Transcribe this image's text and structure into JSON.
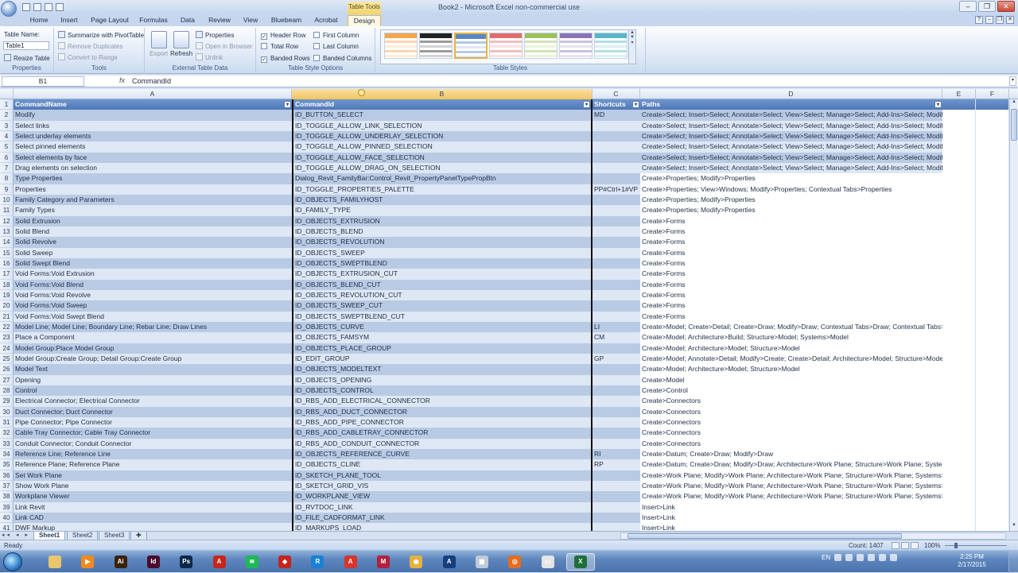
{
  "window": {
    "title": "Book2 - Microsoft Excel non-commercial use",
    "table_tools_label": "Table Tools",
    "controls": {
      "minimize": "–",
      "restore": "❐",
      "close": "✕"
    }
  },
  "tabs": [
    "Home",
    "Insert",
    "Page Layout",
    "Formulas",
    "Data",
    "Review",
    "View",
    "Bluebeam",
    "Acrobat",
    "Design"
  ],
  "ribbon": {
    "properties": {
      "table_name_label": "Table Name:",
      "table_name_value": "Table1",
      "resize_table": "Resize Table",
      "group_label": "Properties"
    },
    "tools": {
      "summarize": "Summarize with PivotTable",
      "remove_duplicates": "Remove Duplicates",
      "convert_to_range": "Convert to Range",
      "group_label": "Tools"
    },
    "external": {
      "export": "Export",
      "refresh": "Refresh",
      "properties": "Properties",
      "open_in_browser": "Open in Browser",
      "unlink": "Unlink",
      "group_label": "External Table Data"
    },
    "style_options": {
      "header_row": "Header Row",
      "total_row": "Total Row",
      "banded_rows": "Banded Rows",
      "first_column": "First Column",
      "last_column": "Last Column",
      "banded_columns": "Banded Columns",
      "group_label": "Table Style Options"
    },
    "table_styles": {
      "group_label": "Table Styles",
      "swatch_colors": [
        "#f3a64b",
        "#222222",
        "#5a86c4",
        "#e06c6c",
        "#9bc25a",
        "#8a74b8",
        "#57b6c9"
      ],
      "selected_index": 2
    }
  },
  "formula_bar": {
    "name_box": "B1",
    "fx": "fx",
    "content": "CommandId"
  },
  "columns": [
    "A",
    "B",
    "C",
    "D",
    "E",
    "F"
  ],
  "table": {
    "headers": [
      "CommandName",
      "CommandId",
      "Shortcuts",
      "Paths"
    ],
    "row_numbers": [
      "1",
      "2",
      "3",
      "4",
      "5",
      "6",
      "7",
      "8",
      "9",
      "10",
      "11",
      "12",
      "13",
      "14",
      "15",
      "16",
      "17",
      "18",
      "19",
      "20",
      "21",
      "22",
      "23",
      "24",
      "25",
      "26",
      "27",
      "28",
      "29",
      "30",
      "31",
      "32",
      "33",
      "34",
      "35",
      "36",
      "37",
      "38",
      "39",
      "40",
      "41"
    ],
    "rows": [
      [
        "Modify",
        "ID_BUTTON_SELECT",
        "MD",
        "Create>Select; Insert>Select; Annotate>Select; View>Select; Manage>Select; Add-Ins>Select; Modify>Select; Arc"
      ],
      [
        "Select links",
        "ID_TOGGLE_ALLOW_LINK_SELECTION",
        "",
        "Create>Select; Insert>Select; Annotate>Select; View>Select; Manage>Select; Add-Ins>Select; Modify>Select; Arc"
      ],
      [
        "Select underlay elements",
        "ID_TOGGLE_ALLOW_UNDERLAY_SELECTION",
        "",
        "Create>Select; Insert>Select; Annotate>Select; View>Select; Manage>Select; Add-Ins>Select; Modify>Select; Arc"
      ],
      [
        "Select pinned elements",
        "ID_TOGGLE_ALLOW_PINNED_SELECTION",
        "",
        "Create>Select; Insert>Select; Annotate>Select; View>Select; Manage>Select; Add-Ins>Select; Modify>Select; Arc"
      ],
      [
        "Select elements by face",
        "ID_TOGGLE_ALLOW_FACE_SELECTION",
        "",
        "Create>Select; Insert>Select; Annotate>Select; View>Select; Manage>Select; Add-Ins>Select; Modify>Select; Arc"
      ],
      [
        "Drag elements on selection",
        "ID_TOGGLE_ALLOW_DRAG_ON_SELECTION",
        "",
        "Create>Select; Insert>Select; Annotate>Select; View>Select; Manage>Select; Add-Ins>Select; Modify>Select; Arc"
      ],
      [
        "Type Properties",
        "Dialog_Revit_FamilyBar:Control_Revit_PropertyPanelTypePropBtn",
        "",
        "Create>Properties; Modify>Properties"
      ],
      [
        "Properties",
        "ID_TOGGLE_PROPERTIES_PALETTE",
        "PP#Ctrl+1#VP",
        "Create>Properties; View>Windows; Modify>Properties; Contextual Tabs>Properties"
      ],
      [
        "Family Category and Parameters",
        "ID_OBJECTS_FAMILYHOST",
        "",
        "Create>Properties; Modify>Properties"
      ],
      [
        "Family Types",
        "ID_FAMILY_TYPE",
        "",
        "Create>Properties; Modify>Properties"
      ],
      [
        "Solid Extrusion",
        "ID_OBJECTS_EXTRUSION",
        "",
        "Create>Forms"
      ],
      [
        "Solid Blend",
        "ID_OBJECTS_BLEND",
        "",
        "Create>Forms"
      ],
      [
        "Solid Revolve",
        "ID_OBJECTS_REVOLUTION",
        "",
        "Create>Forms"
      ],
      [
        "Solid Sweep",
        "ID_OBJECTS_SWEEP",
        "",
        "Create>Forms"
      ],
      [
        "Solid Swept Blend",
        "ID_OBJECTS_SWEPTBLEND",
        "",
        "Create>Forms"
      ],
      [
        "Void Forms:Void Extrusion",
        "ID_OBJECTS_EXTRUSION_CUT",
        "",
        "Create>Forms"
      ],
      [
        "Void Forms:Void Blend",
        "ID_OBJECTS_BLEND_CUT",
        "",
        "Create>Forms"
      ],
      [
        "Void Forms:Void Revolve",
        "ID_OBJECTS_REVOLUTION_CUT",
        "",
        "Create>Forms"
      ],
      [
        "Void Forms:Void Sweep",
        "ID_OBJECTS_SWEEP_CUT",
        "",
        "Create>Forms"
      ],
      [
        "Void Forms:Void Swept Blend",
        "ID_OBJECTS_SWEPTBLEND_CUT",
        "",
        "Create>Forms"
      ],
      [
        "Model Line; Model Line; Boundary Line; Rebar Line; Draw Lines",
        "ID_OBJECTS_CURVE",
        "LI",
        "Create>Model; Create>Detail; Create>Draw; Modify>Draw; Contextual Tabs>Draw; Contextual Tabs>Tools"
      ],
      [
        "Place a Component",
        "ID_OBJECTS_FAMSYM",
        "CM",
        "Create>Model; Architecture>Build; Structure>Model; Systems>Model"
      ],
      [
        "Model Group:Place Model Group",
        "ID_OBJECTS_PLACE_GROUP",
        "",
        "Create>Model; Architecture>Model; Structure>Model"
      ],
      [
        "Model Group:Create Group; Detail Group:Create Group",
        "ID_EDIT_GROUP",
        "GP",
        "Create>Model; Annotate>Detail; Modify>Create; Create>Detail; Architecture>Model; Structure>Model"
      ],
      [
        "Model Text",
        "ID_OBJECTS_MODELTEXT",
        "",
        "Create>Model; Architecture>Model; Structure>Model"
      ],
      [
        "Opening",
        "ID_OBJECTS_OPENING",
        "",
        "Create>Model"
      ],
      [
        "Control",
        "ID_OBJECTS_CONTROL",
        "",
        "Create>Control"
      ],
      [
        "Electrical Connector; Electrical Connector",
        "ID_RBS_ADD_ELECTRICAL_CONNECTOR",
        "",
        "Create>Connectors"
      ],
      [
        "Duct Connector; Duct Connector",
        "ID_RBS_ADD_DUCT_CONNECTOR",
        "",
        "Create>Connectors"
      ],
      [
        "Pipe Connector; Pipe Connector",
        "ID_RBS_ADD_PIPE_CONNECTOR",
        "",
        "Create>Connectors"
      ],
      [
        "Cable Tray Connector; Cable Tray Connector",
        "ID_RBS_ADD_CABLETRAY_CONNECTOR",
        "",
        "Create>Connectors"
      ],
      [
        "Conduit Connector; Conduit Connector",
        "ID_RBS_ADD_CONDUIT_CONNECTOR",
        "",
        "Create>Connectors"
      ],
      [
        "Reference Line; Reference Line",
        "ID_OBJECTS_REFERENCE_CURVE",
        "RI",
        "Create>Datum; Create>Draw; Modify>Draw"
      ],
      [
        "Reference Plane; Reference Plane",
        "ID_OBJECTS_CLINE",
        "RP",
        "Create>Datum; Create>Draw; Modify>Draw; Architecture>Work Plane; Structure>Work Plane; Systems>Work Pla"
      ],
      [
        "Set Work Plane",
        "ID_SKETCH_PLANE_TOOL",
        "",
        "Create>Work Plane; Modify>Work Plane; Architecture>Work Plane; Structure>Work Plane; Systems>Work Plane;"
      ],
      [
        "Show Work Plane",
        "ID_SKETCH_GRID_VIS",
        "",
        "Create>Work Plane; Modify>Work Plane; Architecture>Work Plane; Structure>Work Plane; Systems>Work Plane;"
      ],
      [
        "Workplane Viewer",
        "ID_WORKPLANE_VIEW",
        "",
        "Create>Work Plane; Modify>Work Plane; Architecture>Work Plane; Structure>Work Plane; Systems>Work Plane;"
      ],
      [
        "Link Revit",
        "ID_RVTDOC_LINK",
        "",
        "Insert>Link"
      ],
      [
        "Link CAD",
        "ID_FILE_CADFORMAT_LINK",
        "",
        "Insert>Link"
      ],
      [
        "DWF Markup",
        "ID_MARKUPS_LOAD",
        "",
        "Insert>Link"
      ]
    ]
  },
  "sheets": [
    "Sheet1",
    "Sheet2",
    "Sheet3"
  ],
  "sheet_nav": "◂◂ ◂ ▸ ▸▸",
  "status": {
    "ready": "Ready",
    "count": "Count: 1407",
    "zoom": "100%"
  },
  "taskbar": {
    "apps": [
      "folder",
      "media",
      "Ai",
      "Id",
      "Ps",
      "autodesk",
      "spotify",
      "ruby",
      "revit-r",
      "pdf",
      "mendeley",
      "chrome",
      "revit-a",
      "grid",
      "firefox",
      "window",
      "excel"
    ],
    "app_colors": [
      "#e9c66b",
      "#f08a1d",
      "#3a2207",
      "#4a0c2c",
      "#0b2a4a",
      "#c8261b",
      "#1db954",
      "#c4251d",
      "#1a7fd6",
      "#d8342b",
      "#b2203d",
      "#e8b13c",
      "#143e7e",
      "#c2c9d6",
      "#e66c1e",
      "#e5e5e5",
      "#1d6f37"
    ],
    "app_glyphs": [
      "",
      "▶",
      "Ai",
      "Id",
      "Ps",
      "A",
      "≋",
      "◆",
      "R",
      "A",
      "M",
      "◉",
      "A",
      "▦",
      "◎",
      "▭",
      "X"
    ],
    "lang": "EN",
    "time": "2:25 PM",
    "date": "2/17/2015"
  }
}
